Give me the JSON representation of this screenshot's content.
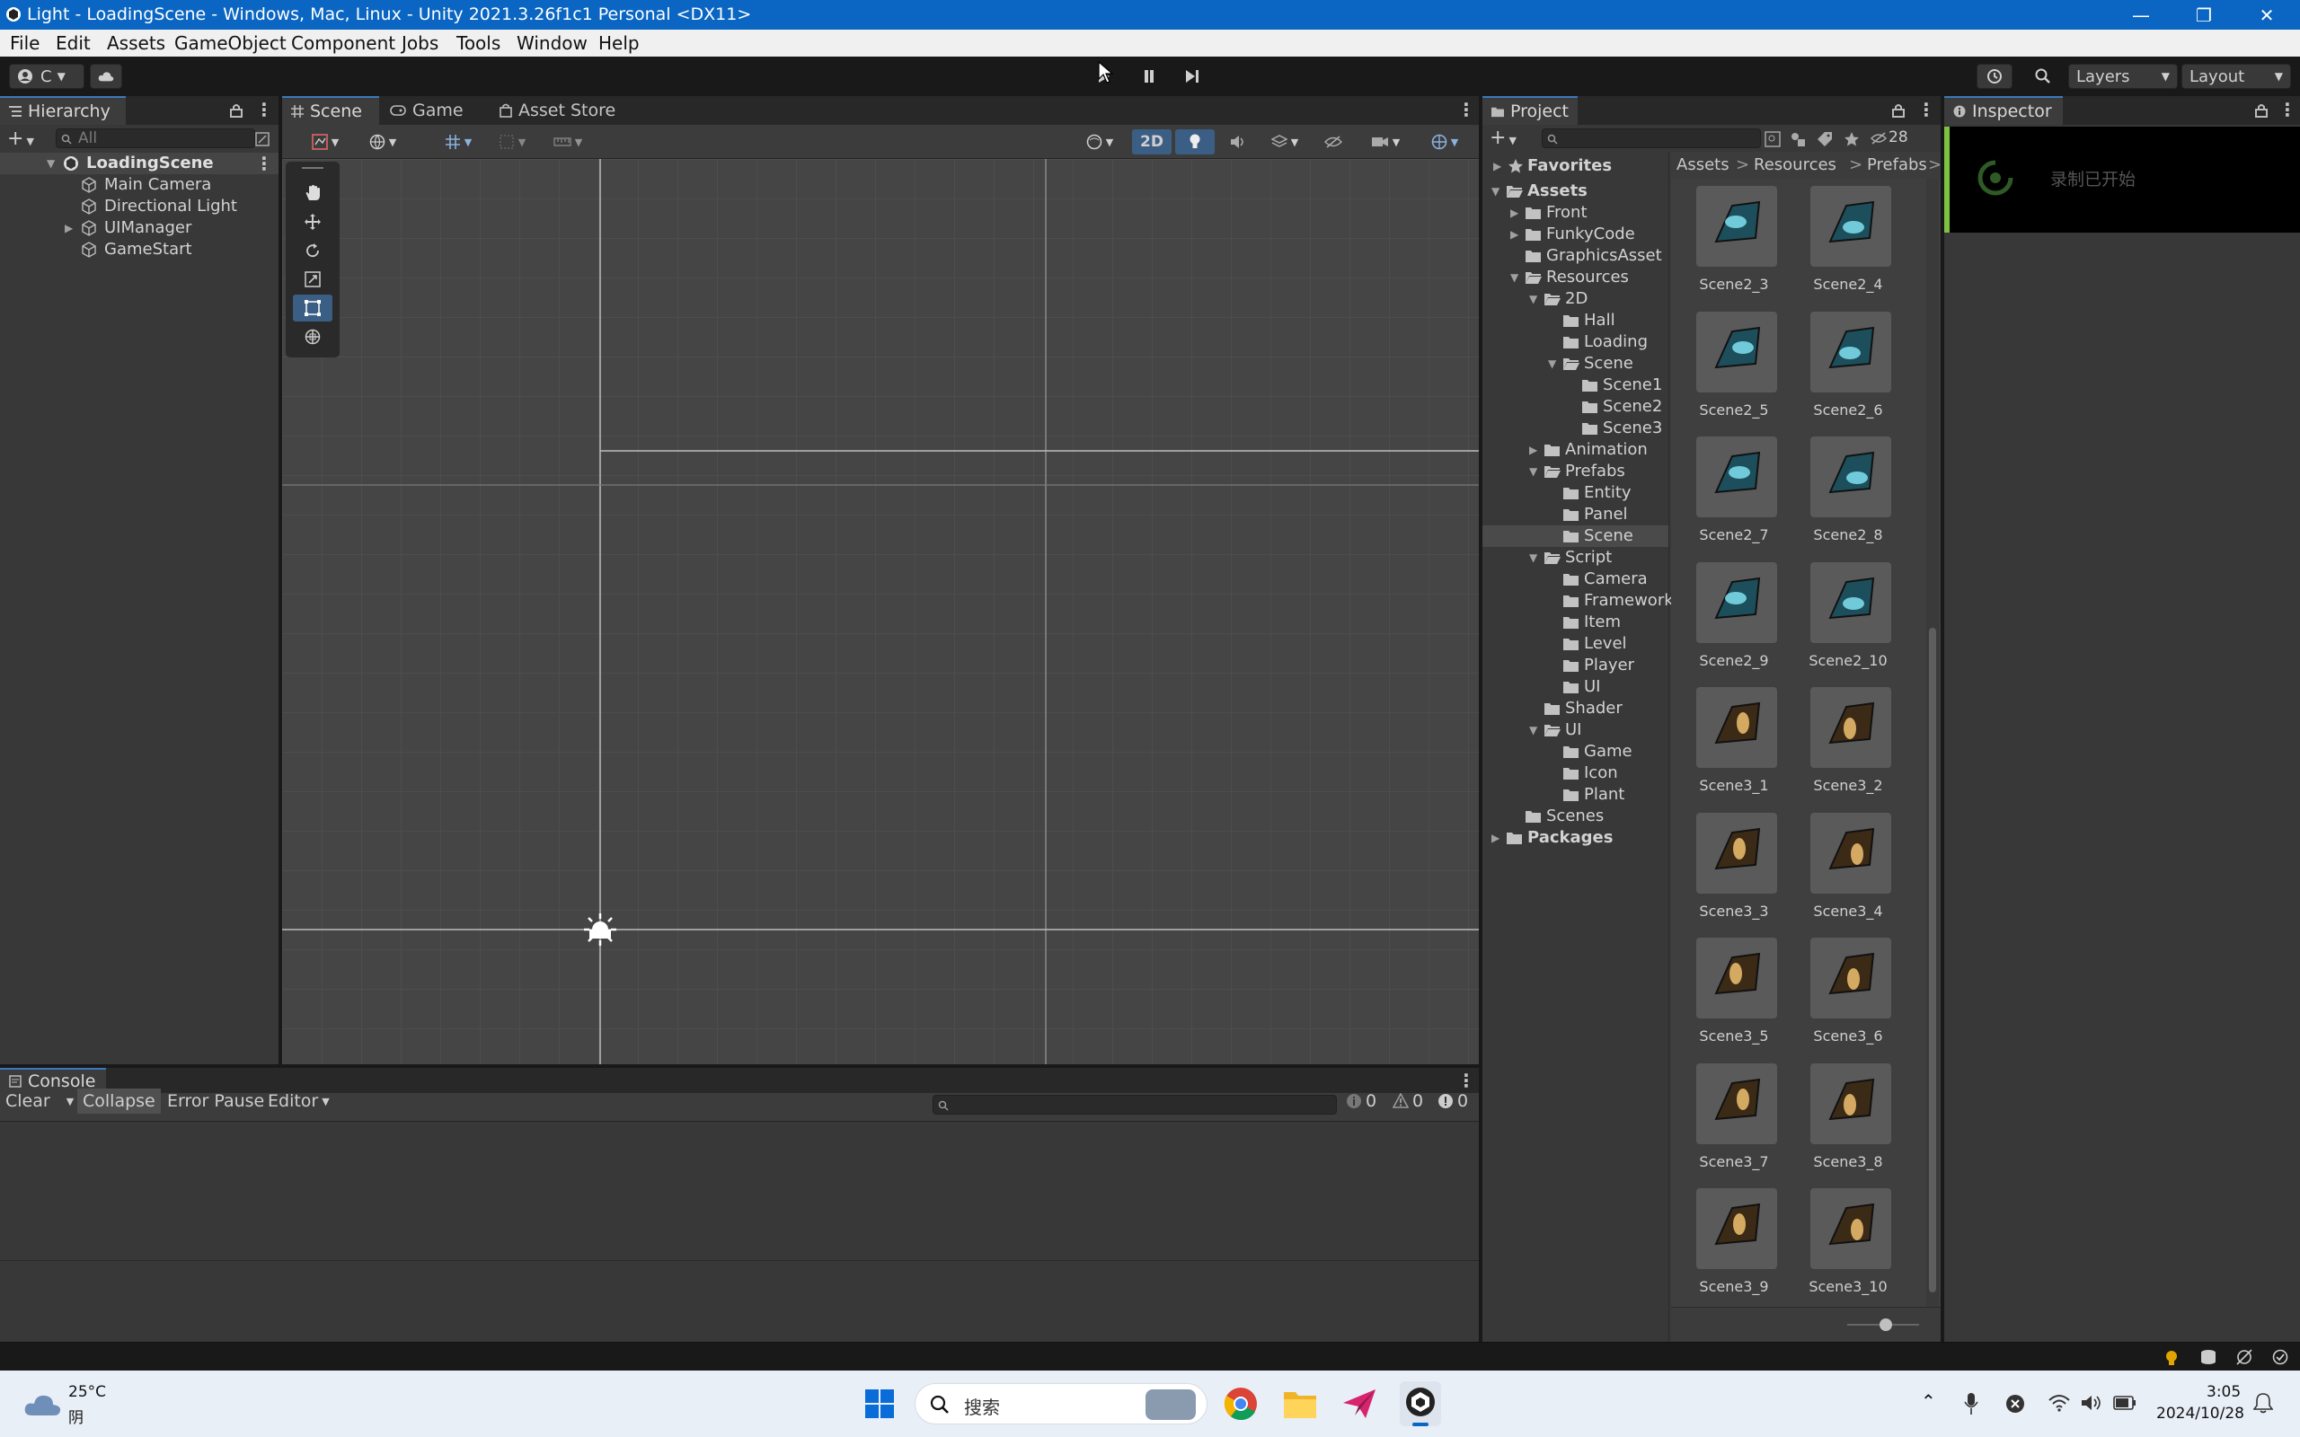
{
  "window": {
    "title": "Light - LoadingScene - Windows, Mac, Linux - Unity 2021.3.26f1c1 Personal <DX11>",
    "minimize": "—",
    "restore": "❐",
    "close": "✕"
  },
  "menu": [
    "File",
    "Edit",
    "Assets",
    "GameObject",
    "Component",
    "Jobs",
    "Tools",
    "Window",
    "Help"
  ],
  "toolbar": {
    "account_label": "C",
    "layers_label": "Layers",
    "layout_label": "Layout"
  },
  "hierarchy": {
    "tab": "Hierarchy",
    "search_placeholder": "All",
    "scene_name": "LoadingScene",
    "items": [
      "Main Camera",
      "Directional Light",
      "UIManager",
      "GameStart"
    ]
  },
  "scene_tabs": [
    "Scene",
    "Game",
    "Asset Store"
  ],
  "scene_toolbar": {
    "mode_2d": "2D"
  },
  "project": {
    "tab": "Project",
    "hidden_count": "28",
    "favorites": "Favorites",
    "breadcrumb": [
      "Assets",
      "Resources",
      "Prefabs"
    ],
    "tree": [
      {
        "label": "Assets",
        "depth": 0,
        "arrow": "open",
        "bold": true
      },
      {
        "label": "Front",
        "depth": 1,
        "arrow": "closed"
      },
      {
        "label": "FunkyCode",
        "depth": 1,
        "arrow": "closed"
      },
      {
        "label": "GraphicsAsset",
        "depth": 1,
        "arrow": "none"
      },
      {
        "label": "Resources",
        "depth": 1,
        "arrow": "open"
      },
      {
        "label": "2D",
        "depth": 2,
        "arrow": "open"
      },
      {
        "label": "Hall",
        "depth": 3,
        "arrow": "none"
      },
      {
        "label": "Loading",
        "depth": 3,
        "arrow": "none"
      },
      {
        "label": "Scene",
        "depth": 3,
        "arrow": "open"
      },
      {
        "label": "Scene1",
        "depth": 4,
        "arrow": "none"
      },
      {
        "label": "Scene2",
        "depth": 4,
        "arrow": "none"
      },
      {
        "label": "Scene3",
        "depth": 4,
        "arrow": "none"
      },
      {
        "label": "Animation",
        "depth": 2,
        "arrow": "closed"
      },
      {
        "label": "Prefabs",
        "depth": 2,
        "arrow": "open"
      },
      {
        "label": "Entity",
        "depth": 3,
        "arrow": "none"
      },
      {
        "label": "Panel",
        "depth": 3,
        "arrow": "none"
      },
      {
        "label": "Scene",
        "depth": 3,
        "arrow": "none",
        "selected": true
      },
      {
        "label": "Script",
        "depth": 2,
        "arrow": "open"
      },
      {
        "label": "Camera",
        "depth": 3,
        "arrow": "none"
      },
      {
        "label": "Framework",
        "depth": 3,
        "arrow": "none"
      },
      {
        "label": "Item",
        "depth": 3,
        "arrow": "none"
      },
      {
        "label": "Level",
        "depth": 3,
        "arrow": "none"
      },
      {
        "label": "Player",
        "depth": 3,
        "arrow": "none"
      },
      {
        "label": "UI",
        "depth": 3,
        "arrow": "none"
      },
      {
        "label": "Shader",
        "depth": 2,
        "arrow": "none"
      },
      {
        "label": "UI",
        "depth": 2,
        "arrow": "open"
      },
      {
        "label": "Game",
        "depth": 3,
        "arrow": "none"
      },
      {
        "label": "Icon",
        "depth": 3,
        "arrow": "none"
      },
      {
        "label": "Plant",
        "depth": 3,
        "arrow": "none"
      },
      {
        "label": "Scenes",
        "depth": 1,
        "arrow": "none"
      },
      {
        "label": "Packages",
        "depth": 0,
        "arrow": "closed",
        "bold": true
      }
    ],
    "assets": [
      {
        "name": "Scene2_3",
        "tint": "teal"
      },
      {
        "name": "Scene2_4",
        "tint": "teal"
      },
      {
        "name": "Scene2_5",
        "tint": "teal"
      },
      {
        "name": "Scene2_6",
        "tint": "teal"
      },
      {
        "name": "Scene2_7",
        "tint": "teal"
      },
      {
        "name": "Scene2_8",
        "tint": "teal"
      },
      {
        "name": "Scene2_9",
        "tint": "teal"
      },
      {
        "name": "Scene2_10",
        "tint": "teal"
      },
      {
        "name": "Scene3_1",
        "tint": "gold"
      },
      {
        "name": "Scene3_2",
        "tint": "gold"
      },
      {
        "name": "Scene3_3",
        "tint": "gold"
      },
      {
        "name": "Scene3_4",
        "tint": "gold"
      },
      {
        "name": "Scene3_5",
        "tint": "gold"
      },
      {
        "name": "Scene3_6",
        "tint": "gold"
      },
      {
        "name": "Scene3_7",
        "tint": "gold"
      },
      {
        "name": "Scene3_8",
        "tint": "gold"
      },
      {
        "name": "Scene3_9",
        "tint": "gold"
      },
      {
        "name": "Scene3_10",
        "tint": "gold"
      }
    ]
  },
  "inspector": {
    "tab": "Inspector",
    "overlay_text": "录制已开始"
  },
  "console": {
    "tab": "Console",
    "clear": "Clear",
    "collapse": "Collapse",
    "error_pause": "Error Pause",
    "editor": "Editor",
    "log_count": "0",
    "warn_count": "0",
    "error_count": "0"
  },
  "taskbar": {
    "temperature": "25°C",
    "weather": "阴",
    "search_placeholder": "搜索",
    "time": "3:05",
    "date": "2024/10/28"
  },
  "colors": {
    "title_bar": "#0a66c2",
    "selection": "#2c5d87",
    "active_tool": "#3b5e85",
    "panel": "#383838"
  }
}
